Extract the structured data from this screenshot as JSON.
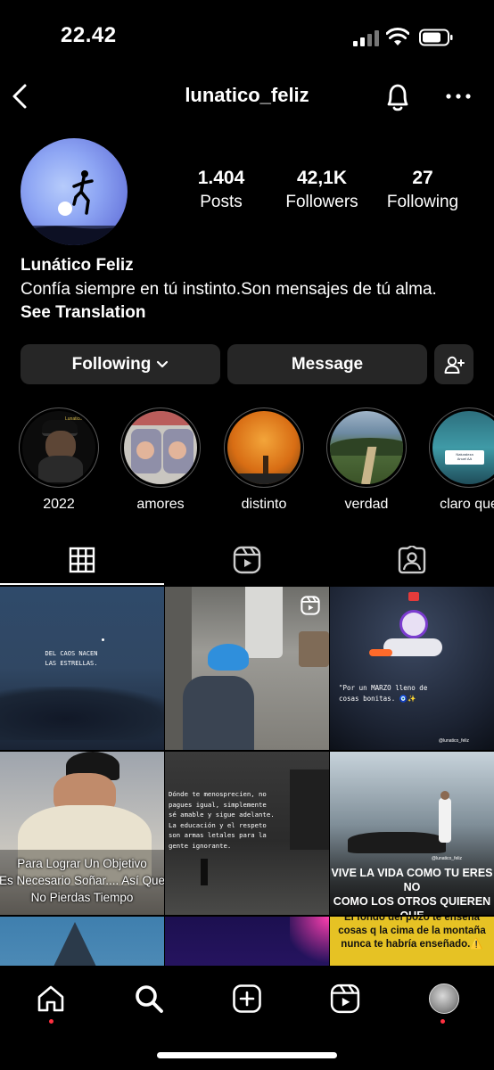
{
  "status": {
    "time": "22.42"
  },
  "nav": {
    "username": "lunatico_feliz"
  },
  "profile": {
    "stats": [
      {
        "value": "1.404",
        "label": "Posts"
      },
      {
        "value": "42,1K",
        "label": "Followers"
      },
      {
        "value": "27",
        "label": "Following"
      }
    ],
    "name": "Lunático Feliz",
    "bio": "Confía siempre en tú instinto.Son mensajes de tú alma.",
    "see_translation": "See Translation"
  },
  "actions": {
    "following": "Following",
    "message": "Message"
  },
  "highlights": [
    {
      "label": "2022"
    },
    {
      "label": "amores"
    },
    {
      "label": "distinto"
    },
    {
      "label": "verdad"
    },
    {
      "label": "claro que"
    }
  ],
  "posts": {
    "p1": "DEL CAOS NACEN\nLAS ESTRELLAS.",
    "p3": "\"Por un MARZO lleno de\ncosas bonitas. 🧿✨",
    "p3_handle": "@lunatico_feliz",
    "p4": "Para Lograr Un Objetivo\nEs Necesario Soñar.... Así Que\nNo Pierdas Tiempo",
    "p5": "Dónde te menosprecien, no\npagues igual, simplemente\nsé amable y sigue adelante.\nLa educación y el respeto\nson armas letales para la\ngente ignorante.",
    "p6": "VIVE LA VIDA COMO TU ERES NO\nCOMO LOS OTROS QUIEREN QUE\nLA VIVAS.",
    "p6_handle": "@lunatico_feliz",
    "p9": "El fondo del pozo te enseña\ncosas q la cima de la montaña\nnunca te habría enseñado.⚠️",
    "hl1_text": "Lunatico Feliz",
    "hl5_badge": "Naturaleza\nAnuel AA"
  },
  "colors": {
    "background": "#000000",
    "button": "#262626",
    "notify_dot": "#ff3040"
  }
}
